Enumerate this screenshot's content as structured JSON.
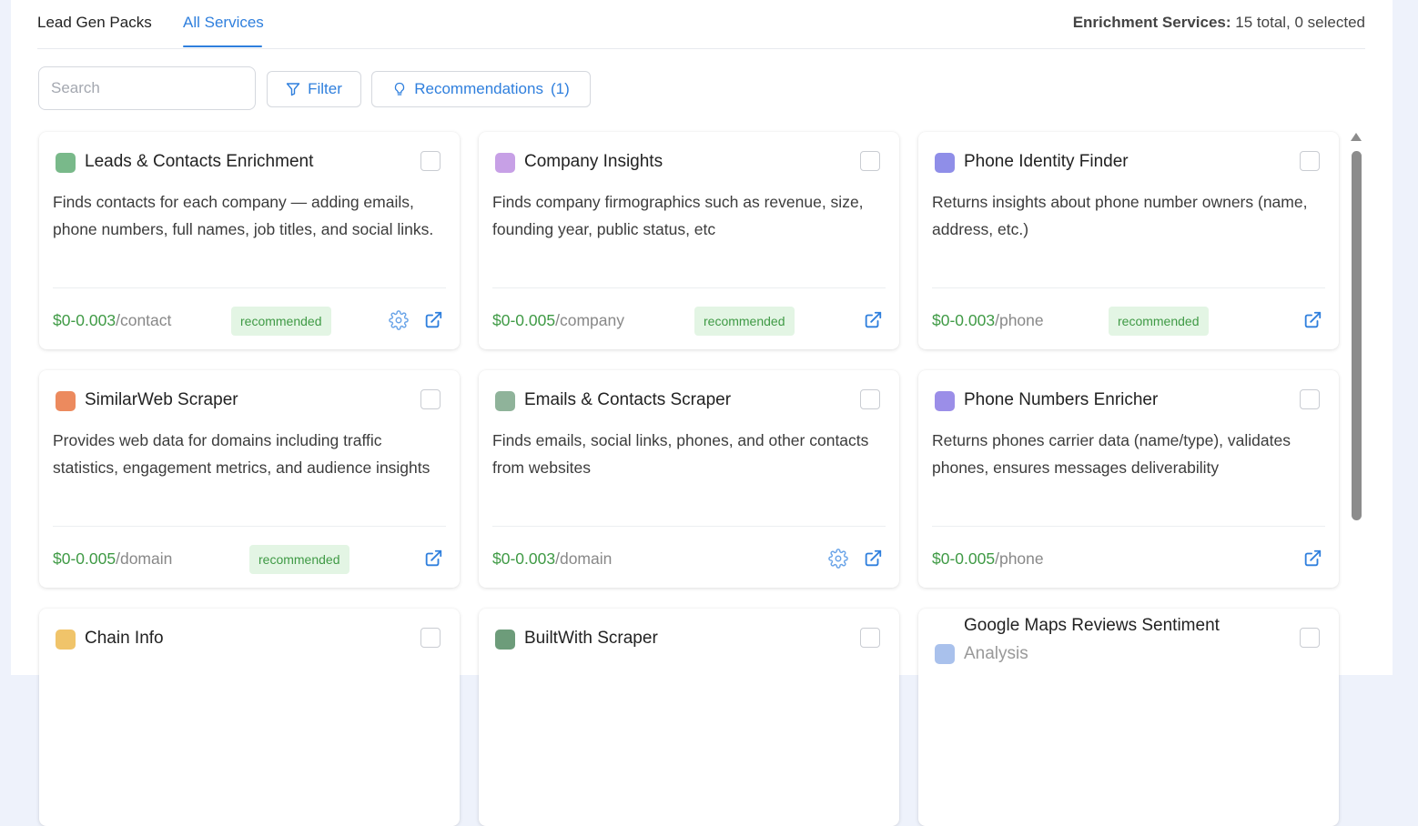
{
  "tabs": [
    {
      "label": "Lead Gen Packs"
    },
    {
      "label": "All Services"
    }
  ],
  "summary": {
    "label": "Enrichment Services:",
    "value": "15 total, 0 selected"
  },
  "search": {
    "placeholder": "Search"
  },
  "filter_label": "Filter",
  "recommendations_label": "Recommendations",
  "recommendations_count": "(1)",
  "colors": {
    "accent": "#2f7fdd",
    "price": "#3f9a45",
    "badge_bg": "#e3f5e4"
  },
  "cards": [
    {
      "title": "Leads & Contacts Enrichment",
      "icon": "leads-icon",
      "icon_color": "#79b98a",
      "desc": "Finds contacts for each company — adding emails, phone numbers, full names, job titles, and social links.",
      "price": "$0-0.003",
      "unit": "/contact",
      "badge": "recommended",
      "settings": true
    },
    {
      "title": "Company Insights",
      "icon": "bulb-icon",
      "icon_color": "#c7a0e6",
      "desc": "Finds company firmographics such as revenue, size, founding year, public status, etc",
      "price": "$0-0.005",
      "unit": "/company",
      "badge": "recommended",
      "settings": false
    },
    {
      "title": "Phone Identity Finder",
      "icon": "phone-id-icon",
      "icon_color": "#8f8ee8",
      "desc": "Returns insights about phone number owners (name, address, etc.)",
      "price": "$0-0.003",
      "unit": "/phone",
      "badge": "recommended",
      "settings": false
    },
    {
      "title": "SimilarWeb Scraper",
      "icon": "similarweb-icon",
      "icon_color": "#ec8a5e",
      "desc": "Provides web data for domains including traffic statistics, engagement metrics, and audience insights",
      "price": "$0-0.005",
      "unit": "/domain",
      "badge": "recommended",
      "settings": false
    },
    {
      "title": "Emails & Contacts Scraper",
      "icon": "email-icon",
      "icon_color": "#8fb39a",
      "desc": "Finds emails, social links, phones, and other contacts from websites",
      "price": "$0-0.003",
      "unit": "/domain",
      "badge": "",
      "settings": true
    },
    {
      "title": "Phone Numbers Enricher",
      "icon": "phone-icon",
      "icon_color": "#9b8ee8",
      "desc": "Returns phones carrier data (name/type), validates phones, ensures messages deliverability",
      "price": "$0-0.005",
      "unit": "/phone",
      "badge": "",
      "settings": false
    },
    {
      "title": "Chain Info",
      "icon": "chain-icon",
      "icon_color": "#f0c46a",
      "desc": "",
      "price": "",
      "unit": "",
      "badge": "",
      "settings": false
    },
    {
      "title": "BuiltWith Scraper",
      "icon": "builtwith-icon",
      "icon_color": "#6d9c7a",
      "desc": "",
      "price": "",
      "unit": "",
      "badge": "",
      "settings": false
    },
    {
      "title": "Google Maps Reviews Sentiment",
      "title2": "Analysis",
      "icon": "maps-sentiment-icon",
      "icon_color": "#a9c1ec",
      "desc": "",
      "price": "",
      "unit": "",
      "badge": "",
      "settings": false
    }
  ]
}
